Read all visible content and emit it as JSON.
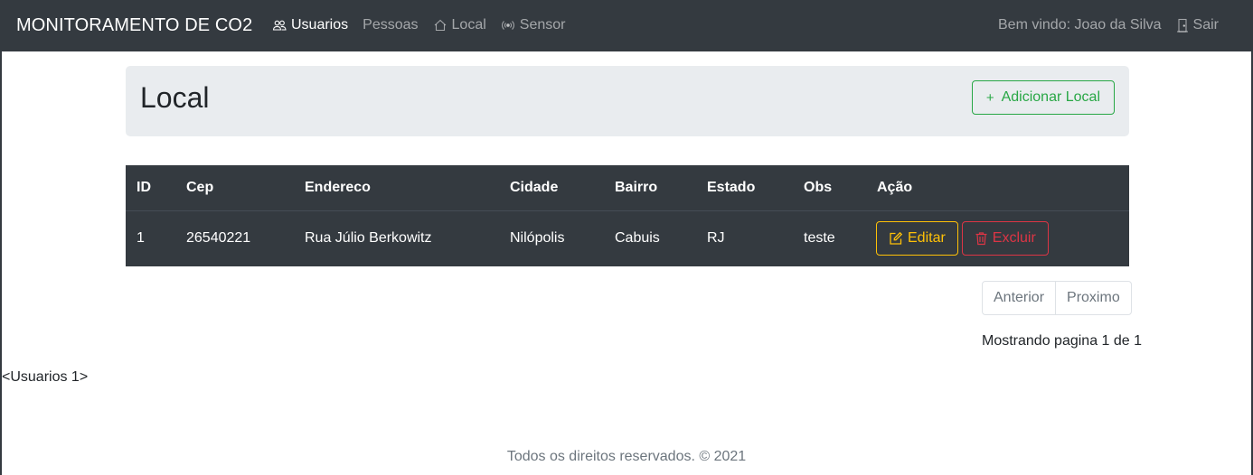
{
  "navbar": {
    "brand": "MONITORAMENTO DE CO2",
    "links": [
      {
        "label": "Usuarios",
        "icon": "people-icon",
        "active": true
      },
      {
        "label": "Pessoas",
        "icon": "",
        "active": false
      },
      {
        "label": "Local",
        "icon": "house-icon",
        "active": false
      },
      {
        "label": "Sensor",
        "icon": "broadcast-icon",
        "active": false
      }
    ],
    "welcome": "Bem vindo: Joao da Silva",
    "logout_label": "Sair",
    "logout_icon": "door-icon"
  },
  "header": {
    "title": "Local",
    "add_button_label": "Adicionar Local",
    "add_button_icon": "plus-icon"
  },
  "table": {
    "columns": [
      "ID",
      "Cep",
      "Endereco",
      "Cidade",
      "Bairro",
      "Estado",
      "Obs",
      "Ação"
    ],
    "rows": [
      {
        "id": "1",
        "cep": "26540221",
        "endereco": "Rua Júlio Berkowitz",
        "cidade": "Nilópolis",
        "bairro": "Cabuis",
        "estado": "RJ",
        "obs": "teste",
        "edit_label": "Editar",
        "delete_label": "Excluir"
      }
    ]
  },
  "pagination": {
    "prev_label": "Anterior",
    "next_label": "Proximo",
    "info": "Mostrando pagina 1 de 1"
  },
  "debug_text": "<Usuarios 1>",
  "footer": "Todos os direitos reservados. © 2021",
  "colors": {
    "navbar_bg": "#343a40",
    "success": "#28a745",
    "warning": "#ffc107",
    "danger": "#dc3545",
    "jumbotron_bg": "#e9ecef"
  }
}
